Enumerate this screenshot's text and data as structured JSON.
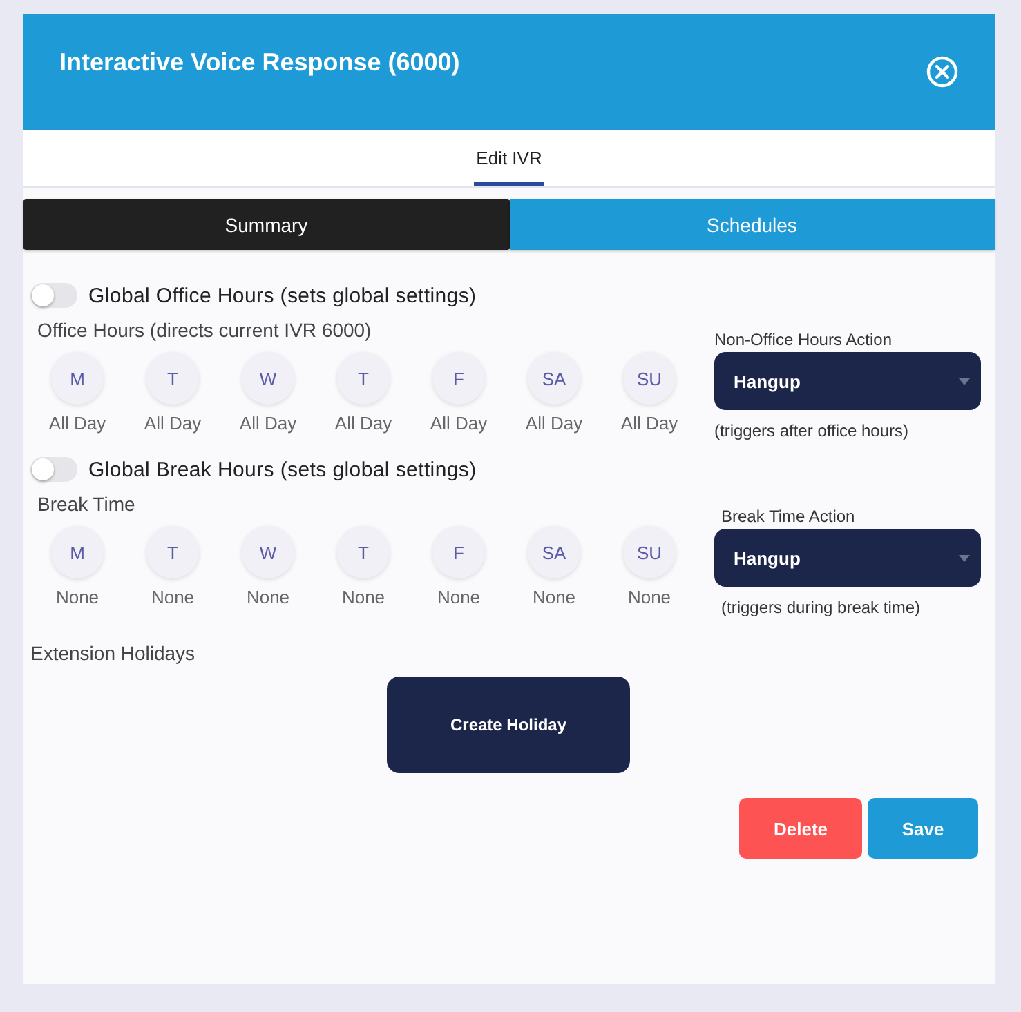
{
  "dialog": {
    "title": "Interactive Voice Response (6000)"
  },
  "subtab": {
    "label": "Edit IVR",
    "selected": true
  },
  "tabs": [
    {
      "label": "Summary",
      "selected": true
    },
    {
      "label": "Schedules",
      "selected": false
    }
  ],
  "schedules": [
    {
      "toggle": {
        "label": "Global Office Hours (sets global settings)",
        "on": false
      },
      "heading": "Office Hours (directs current IVR 6000)",
      "days": [
        {
          "day": "M",
          "value": "All Day"
        },
        {
          "day": "T",
          "value": "All Day"
        },
        {
          "day": "W",
          "value": "All Day"
        },
        {
          "day": "T",
          "value": "All Day"
        },
        {
          "day": "F",
          "value": "All Day"
        },
        {
          "day": "SA",
          "value": "All Day"
        },
        {
          "day": "SU",
          "value": "All Day"
        }
      ],
      "action_label": "Non-Office Hours Action",
      "action_value": "Hangup",
      "action_note": "(triggers after office hours)"
    },
    {
      "toggle": {
        "label": "Global Break Hours (sets global settings)",
        "on": false
      },
      "heading": "Break Time",
      "days": [
        {
          "day": "M",
          "value": "None"
        },
        {
          "day": "T",
          "value": "None"
        },
        {
          "day": "W",
          "value": "None"
        },
        {
          "day": "T",
          "value": "None"
        },
        {
          "day": "F",
          "value": "None"
        },
        {
          "day": "SA",
          "value": "None"
        },
        {
          "day": "SU",
          "value": "None"
        }
      ],
      "action_label": "Break Time Action",
      "action_value": "Hangup",
      "action_note": "(triggers during break time)"
    }
  ],
  "holidays": {
    "label": "Extension Holidays",
    "button": "Create Holiday"
  },
  "buttons": [
    {
      "label": "Delete",
      "kind": "danger"
    },
    {
      "label": "Save",
      "kind": "primary"
    }
  ]
}
